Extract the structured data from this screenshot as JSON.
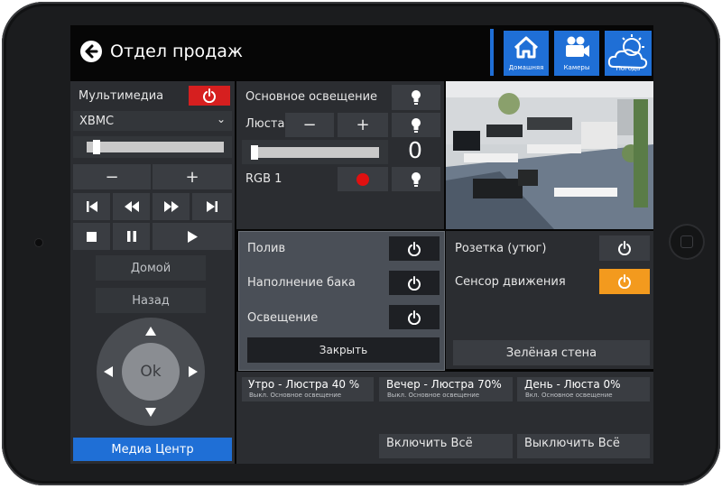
{
  "header": {
    "title": "Отдел продаж",
    "nav": [
      {
        "label": "Домашняя",
        "icon": "home-icon"
      },
      {
        "label": "Камеры",
        "icon": "camera-icon"
      },
      {
        "label": "Погода",
        "icon": "weather-icon"
      }
    ]
  },
  "media": {
    "label": "Мультимедиа",
    "source": "XBMC",
    "volume": 0.05,
    "minus": "−",
    "plus": "+",
    "home_label": "Домой",
    "back_label": "Назад",
    "ok_label": "Ok",
    "center_label": "Медиа Центр"
  },
  "lighting": {
    "main_label": "Основное освещение",
    "chandelier_label": "Люста",
    "minus": "−",
    "plus": "+",
    "level_value": "0",
    "level": 0.0,
    "rgb_label": "RGB 1",
    "rgb_color": "#e01010"
  },
  "popup": {
    "items": [
      {
        "label": "Полив"
      },
      {
        "label": "Наполнение бака"
      },
      {
        "label": "Освещение"
      }
    ],
    "close_label": "Закрыть"
  },
  "right_panel": {
    "socket_label": "Розетка (утюг)",
    "motion_label": "Сенсор движения",
    "motion_active_color": "#f39a1e",
    "wall_label": "Зелёная стена"
  },
  "scenes": [
    {
      "title": "Утро - Люстра 40 %",
      "sub": "Выкл. Основное освещение"
    },
    {
      "title": "Вечер - Люстра 70%",
      "sub": "Выкл. Основное освещение"
    },
    {
      "title": "День - Люста 0%",
      "sub": "Вкл. Основное освещение"
    }
  ],
  "actions": {
    "all_on": "Включить Всё",
    "all_off": "Выключить Всё"
  },
  "colors": {
    "accent_blue": "#1f6fd6",
    "power_red": "#d61f1f",
    "nav_blue": "#1f6fd6"
  }
}
